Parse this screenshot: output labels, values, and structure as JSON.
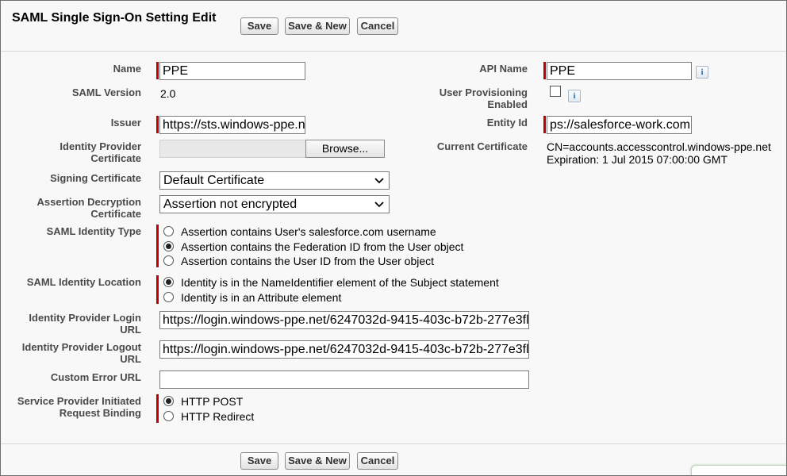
{
  "header": {
    "title": "SAML Single Sign-On Setting Edit",
    "save_label": "Save",
    "save_new_label": "Save & New",
    "cancel_label": "Cancel"
  },
  "footer": {
    "save_label": "Save",
    "save_new_label": "Save & New",
    "cancel_label": "Cancel"
  },
  "form": {
    "name": {
      "label": "Name",
      "value": "PPE"
    },
    "api_name": {
      "label": "API Name",
      "value": "PPE",
      "info_icon": "i"
    },
    "saml_version": {
      "label": "SAML Version",
      "value": "2.0"
    },
    "user_provisioning": {
      "label": "User Provisioning Enabled",
      "checked": false,
      "info_icon": "i"
    },
    "issuer": {
      "label": "Issuer",
      "value": "https://sts.windows-ppe.n"
    },
    "entity_id": {
      "label": "Entity Id",
      "value": "ps://salesforce-work.com"
    },
    "idp_certificate": {
      "label": "Identity Provider Certificate",
      "browse_label": "Browse..."
    },
    "current_certificate": {
      "label": "Current Certificate",
      "line1": "CN=accounts.accesscontrol.windows-ppe.net",
      "line2": "Expiration: 1 Jul 2015 07:00:00 GMT"
    },
    "signing_certificate": {
      "label": "Signing Certificate",
      "selected": "Default Certificate"
    },
    "assertion_decryption": {
      "label": "Assertion Decryption Certificate",
      "selected": "Assertion not encrypted"
    },
    "saml_identity_type": {
      "label": "SAML Identity Type",
      "options": [
        {
          "text": "Assertion contains User's salesforce.com username",
          "selected": false
        },
        {
          "text": "Assertion contains the Federation ID from the User object",
          "selected": true
        },
        {
          "text": "Assertion contains the User ID from the User object",
          "selected": false
        }
      ]
    },
    "saml_identity_location": {
      "label": "SAML Identity Location",
      "options": [
        {
          "text": "Identity is in the NameIdentifier element of the Subject statement",
          "selected": true
        },
        {
          "text": "Identity is in an Attribute element",
          "selected": false
        }
      ]
    },
    "idp_login_url": {
      "label": "Identity Provider Login URL",
      "value": "https://login.windows-ppe.net/6247032d-9415-403c-b72b-277e3fl"
    },
    "idp_logout_url": {
      "label": "Identity Provider Logout URL",
      "value": "https://login.windows-ppe.net/6247032d-9415-403c-b72b-277e3fl"
    },
    "custom_error_url": {
      "label": "Custom Error URL",
      "value": ""
    },
    "sp_request_binding": {
      "label": "Service Provider Initiated Request Binding",
      "options": [
        {
          "text": "HTTP POST",
          "selected": true
        },
        {
          "text": "HTTP Redirect",
          "selected": false
        }
      ]
    }
  },
  "colors": {
    "required_bar": "#c00000",
    "background": "#f8f8f8"
  }
}
